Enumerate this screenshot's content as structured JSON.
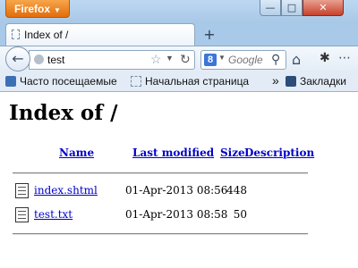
{
  "browser": {
    "app_button": "Firefox",
    "window_controls": {
      "minimize": "—",
      "maximize": "□",
      "close": "✕"
    },
    "tab": {
      "title": "Index of /"
    },
    "new_tab_label": "+",
    "url_text": "test",
    "search_engine_letter": "8",
    "search_placeholder": "Google",
    "bookmarks": [
      {
        "label": "Часто посещаемые"
      },
      {
        "label": "Начальная страница"
      },
      {
        "label": "Закладки"
      }
    ],
    "more_bookmarks": "»"
  },
  "page": {
    "heading": "Index of /",
    "columns": [
      "Name",
      "Last modified",
      "Size",
      "Description"
    ],
    "rows": [
      {
        "name": "index.shtml",
        "modified": "01-Apr-2013 08:56",
        "size": "448",
        "description": ""
      },
      {
        "name": "test.txt",
        "modified": "01-Apr-2013 08:58",
        "size": "50",
        "description": ""
      }
    ]
  }
}
